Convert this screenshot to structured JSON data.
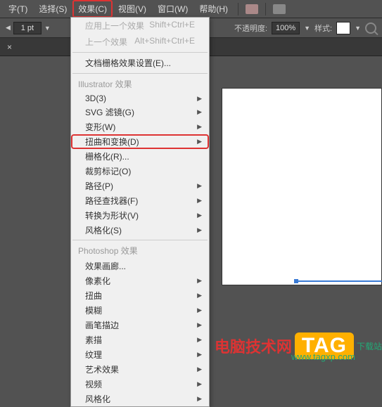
{
  "menubar": {
    "items": [
      "字(T)",
      "选择(S)",
      "效果(C)",
      "视图(V)",
      "窗口(W)",
      "帮助(H)"
    ]
  },
  "toolbar": {
    "stroke_value": "1 pt",
    "opacity_label": "不透明度:",
    "opacity_value": "100%",
    "style_label": "样式:"
  },
  "dropdown": {
    "apply_last": "应用上一个效果",
    "apply_last_key": "Shift+Ctrl+E",
    "last_effect": "上一个效果",
    "last_effect_key": "Alt+Shift+Ctrl+E",
    "doc_raster": "文档栅格效果设置(E)...",
    "section_ai": "Illustrator 效果",
    "ai_items": [
      "3D(3)",
      "SVG 滤镜(G)",
      "变形(W)",
      "扭曲和变换(D)",
      "栅格化(R)...",
      "裁剪标记(O)",
      "路径(P)",
      "路径查找器(F)",
      "转换为形状(V)",
      "风格化(S)"
    ],
    "section_ps": "Photoshop 效果",
    "ps_items": [
      "效果画廊...",
      "像素化",
      "扭曲",
      "模糊",
      "画笔描边",
      "素描",
      "纹理",
      "艺术效果",
      "视频",
      "风格化"
    ]
  },
  "watermark": {
    "brand": "电脑技术网",
    "tag": "TAG",
    "tail": "下载站",
    "url": "www.tagxp.com"
  }
}
